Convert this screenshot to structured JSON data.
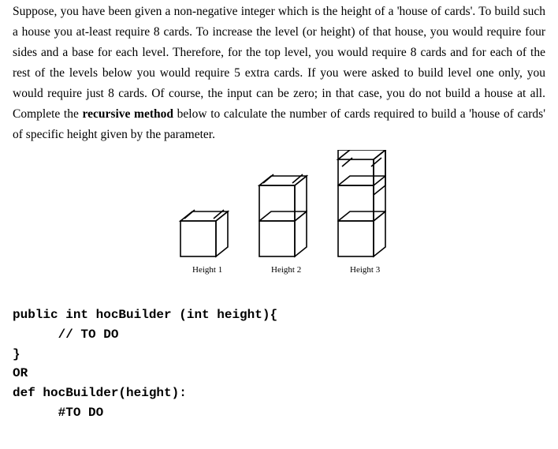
{
  "problem": {
    "t1": "Suppose, you have been given a non-negative integer which is the height of a 'house of cards'. To build such a house you at-least require 8 cards. To increase the level (or height) of that house, you would require four sides and a base for each level. Therefore, for the top level, you would require 8 cards and for each of the rest of the levels below you would require 5 extra cards. If you were asked to build level one only, you would require just 8 cards. Of course, the input can be zero; in that case, you do not build a house at all. Complete the ",
    "t2": "recursive method",
    "t3": " below to calculate the number of cards required to build a 'house of cards' of specific height given by the parameter."
  },
  "labels": {
    "h1": "Height 1",
    "h2": "Height 2",
    "h3": "Height 3"
  },
  "code": {
    "java_sig": "public int hocBuilder (int height){",
    "java_todo": "      // TO DO",
    "java_close": "}",
    "or": "OR",
    "py_sig": "def hocBuilder(height):",
    "py_todo": "      #TO DO"
  }
}
